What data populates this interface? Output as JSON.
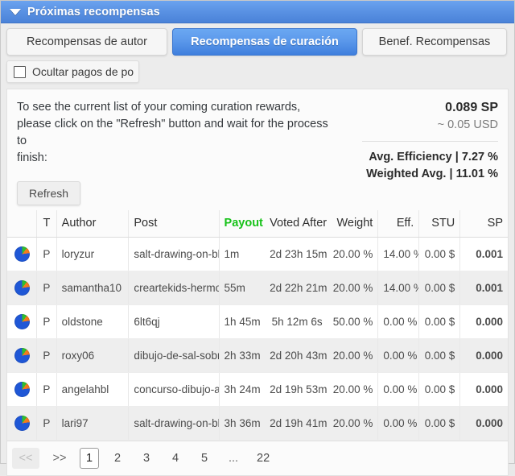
{
  "window": {
    "title": "Próximas recompensas",
    "collapse_icon": "triangle-down-icon"
  },
  "tabs": [
    {
      "label": "Recompensas de autor",
      "active": false
    },
    {
      "label": "Recompensas de curación",
      "active": true
    },
    {
      "label": "Benef. Recompensas",
      "active": false
    }
  ],
  "filter": {
    "checkbox_label": "Ocultar pagos de po",
    "checked": false
  },
  "info": {
    "line1": "To see the current list of your coming curation rewards,",
    "line2": "please click on the \"Refresh\" button and wait for the process to",
    "line3": "finish:",
    "refresh_label": "Refresh"
  },
  "summary": {
    "sp_total": "0.089 SP",
    "usd_approx": "~ 0.05 USD",
    "avg_efficiency": "Avg. Efficiency | 7.27 %",
    "weighted_avg": "Weighted Avg. | 11.01 %"
  },
  "table": {
    "headers": {
      "icon": "",
      "type": "T",
      "author": "Author",
      "post": "Post",
      "payout_in": "Payout In",
      "voted_after": "Voted After",
      "weight": "Weight",
      "eff": "Eff.",
      "stu": "STU",
      "sp": "SP"
    },
    "rows": [
      {
        "icon": "pie-chart-icon",
        "type": "P",
        "author": "loryzur",
        "post": "salt-drawing-on-black-ca",
        "payout_in": "1m",
        "voted_after": "2d 23h 15m",
        "weight": "20.00 %",
        "eff": "14.00 %",
        "stu": "0.00 $",
        "sp": "0.001"
      },
      {
        "icon": "pie-chart-icon",
        "type": "P",
        "author": "samantha10",
        "post": "creartekids-hermoso-po",
        "payout_in": "55m",
        "voted_after": "2d 22h 21m",
        "weight": "20.00 %",
        "eff": "14.00 %",
        "stu": "0.00 $",
        "sp": "0.001"
      },
      {
        "icon": "pie-chart-icon",
        "type": "P",
        "author": "oldstone",
        "post": "6lt6qj",
        "payout_in": "1h 45m",
        "voted_after": "5h 12m 6s",
        "weight": "50.00 %",
        "eff": "0.00 %",
        "stu": "0.00 $",
        "sp": "0.000"
      },
      {
        "icon": "pie-chart-icon",
        "type": "P",
        "author": "roxy06",
        "post": "dibujo-de-sal-sobre-lienz",
        "payout_in": "2h 33m",
        "voted_after": "2d 20h 43m",
        "weight": "20.00 %",
        "eff": "0.00 %",
        "stu": "0.00 $",
        "sp": "0.000"
      },
      {
        "icon": "pie-chart-icon",
        "type": "P",
        "author": "angelahbl",
        "post": "concurso-dibujo-a-la-sal-",
        "payout_in": "3h 24m",
        "voted_after": "2d 19h 53m",
        "weight": "20.00 %",
        "eff": "0.00 %",
        "stu": "0.00 $",
        "sp": "0.000"
      },
      {
        "icon": "pie-chart-icon",
        "type": "P",
        "author": "lari97",
        "post": "salt-drawing-on-black-ca",
        "payout_in": "3h 36m",
        "voted_after": "2d 19h 41m",
        "weight": "20.00 %",
        "eff": "0.00 %",
        "stu": "0.00 $",
        "sp": "0.000"
      }
    ]
  },
  "pagination": {
    "first_label": "<<",
    "next_label": ">>",
    "pages": [
      "1",
      "2",
      "3",
      "4",
      "5",
      "...",
      "22"
    ],
    "current": "1"
  },
  "colors": {
    "accent_blue": "#4a82d8",
    "link_blue": "#3b6fd4",
    "payout_green": "#17c219",
    "pie_blue": "#1f57d6",
    "pie_green": "#2fbe2f",
    "pie_orange": "#f27a1d"
  }
}
